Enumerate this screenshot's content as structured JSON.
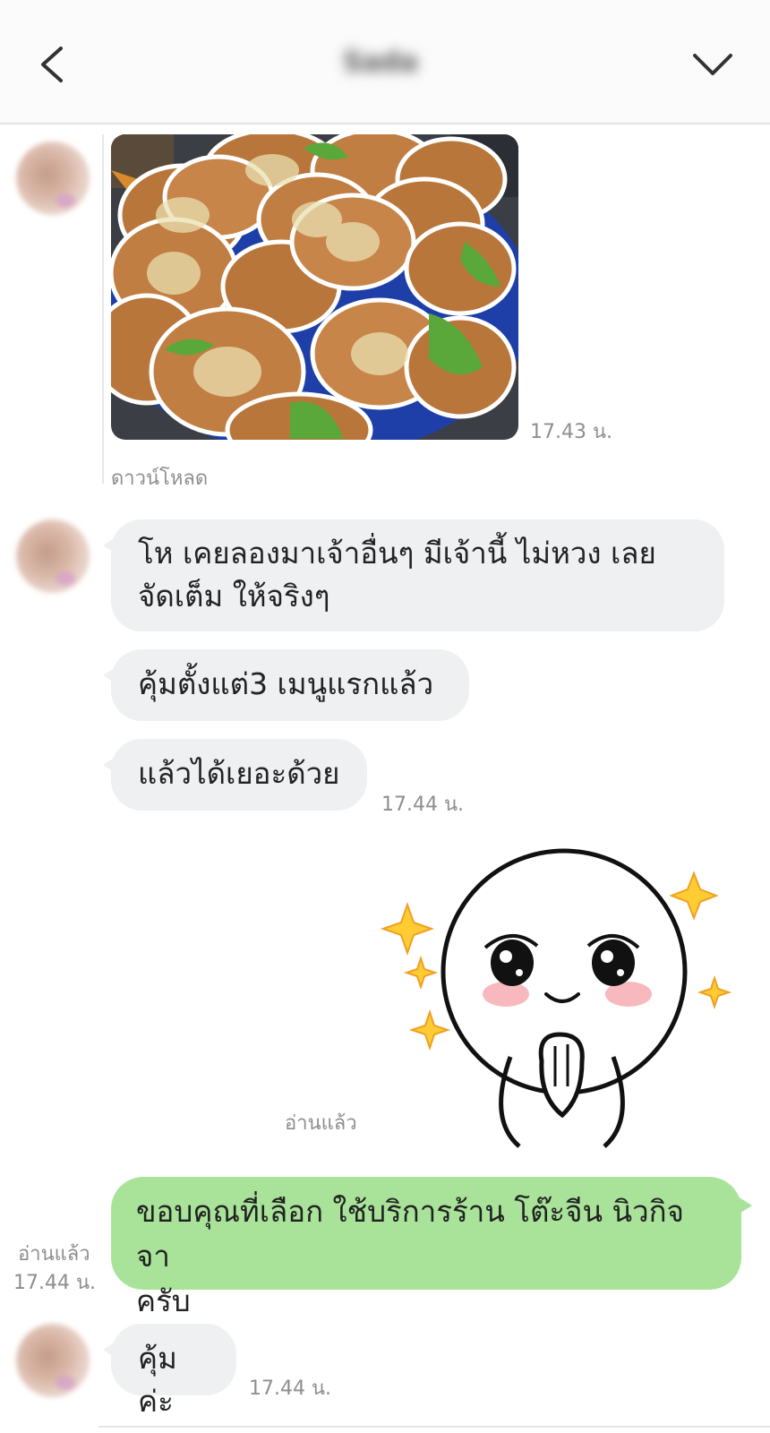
{
  "header": {
    "title": "Sada",
    "back_icon": "chevron-left-icon",
    "menu_icon": "chevron-down-icon"
  },
  "messages": {
    "photo": {
      "time": "17.43 น.",
      "download_label": "ดาวน์โหลด"
    },
    "incoming_1": {
      "line1": "โห เคยลองมาเจ้าอื่นๆ มีเจ้านี้ ไม่หวง เลย",
      "line2": "จัดเต็ม ให้จริงๆ"
    },
    "incoming_2": "คุ้มตั้งแต่3 เมนูแรกแล้ว",
    "incoming_3": "แล้วได้เยอะด้วย",
    "incoming_group_time": "17.44 น.",
    "sticker": {
      "read_label": "อ่านแล้ว",
      "icon": "praying-face-sticker"
    },
    "outgoing": {
      "line1": "ขอบคุณที่เลือก ใช้บริการร้าน โต๊ะจีน นิวกิจจา",
      "line2": "ครับ",
      "read_label": "อ่านแล้ว",
      "time": "17.44 น."
    },
    "incoming_4": {
      "text": "คุ้มค่ะ",
      "time": "17.44 น."
    }
  },
  "colors": {
    "incoming_bubble": "#eef0f2",
    "outgoing_bubble": "#a8e399",
    "timestamp": "#8e8e8e"
  }
}
